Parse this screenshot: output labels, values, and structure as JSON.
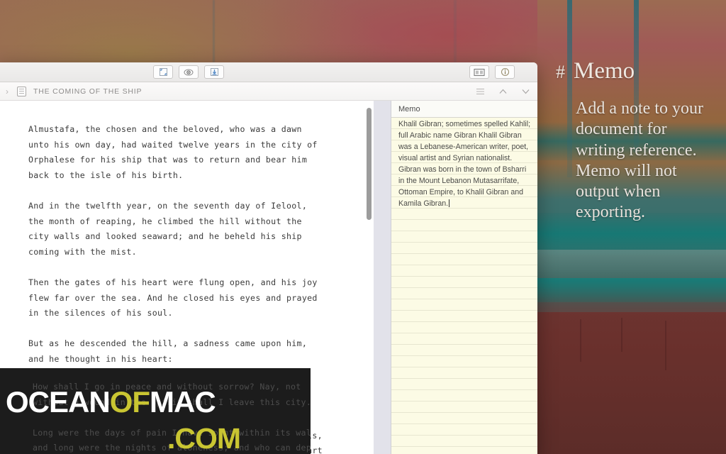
{
  "desktop": {
    "wallpaper_name": "abstract-painting-wallpaper"
  },
  "promo": {
    "hash": "#",
    "title": "Memo",
    "body": "Add a note to your document for writing reference. Memo will not output when exporting."
  },
  "window": {
    "toolbar": {
      "left_buttons": [
        {
          "name": "fullscreen-icon",
          "label": "Full Screen"
        },
        {
          "name": "focus-mode-icon",
          "label": "Focus Mode"
        },
        {
          "name": "export-icon",
          "label": "Export"
        }
      ],
      "right_buttons": [
        {
          "name": "split-view-icon",
          "label": "Split View"
        },
        {
          "name": "info-icon",
          "label": "Info"
        }
      ]
    },
    "chapter_bar": {
      "expand_chevron": "›",
      "doc_icon": "document-icon",
      "title": "THE COMING OF THE SHIP",
      "icons": [
        {
          "name": "list-icon",
          "label": "Outline"
        },
        {
          "name": "chevron-up-icon",
          "label": "Previous"
        },
        {
          "name": "chevron-down-icon",
          "label": "Next"
        }
      ]
    },
    "document": {
      "paragraphs": [
        "Almustafa, the chosen and the beloved, who was a dawn\nunto his own day, had waited twelve years in the city of\nOrphalese for his ship that was to return and bear him\nback to the isle of his birth.",
        "And in the twelfth year, on the seventh day of Ielool,\nthe month of reaping, he climbed the hill without the\ncity walls and looked seaward; and he beheld his ship\ncoming with the mist.",
        "Then the gates of his heart were flung open, and his joy\nflew far over the sea. And he closed his eyes and prayed\nin the silences of his soul.",
        "But as he descended the hill, a sadness came upon him,\nand he thought in his heart:",
        "How shall I go in peace and without sorrow? Nay, not\nwithout a wound in the spirit shall I leave this city.",
        "Long were the days of pain I have spent within its walls,\nand long were the nights of aloneness; and who can depart"
      ]
    },
    "memo": {
      "header": "Memo",
      "lines": [
        "Khalil Gibran; sometimes spelled Kahlil;",
        "full Arabic name Gibran Khalil Gibran",
        "was a Lebanese-American writer, poet,",
        "visual artist and Syrian nationalist.",
        "Gibran was born in the town of Bsharri",
        "in the Mount Lebanon Mutasarrifate,",
        "Ottoman Empire, to Khalil Gibran and",
        "Kamila Gibran."
      ]
    }
  },
  "watermark": {
    "part1": "OCEAN",
    "part2": "OF",
    "part3": "MAC",
    "part4": ".COM",
    "ghost_lines": [
      "How shall I go in peace and without sorrow? Nay, not",
      "without a wound in the spirit shall I leave this city.",
      "",
      "Long were the days of pain I have spent within its walls,",
      "and long were the nights of aloneness; and who can depart"
    ]
  },
  "colors": {
    "accent_yellow": "#c9c532",
    "memo_paper": "#fcfbe5",
    "window_chrome": "#f2f1f0",
    "toolbar_icon_blue": "#5b8fc9"
  }
}
